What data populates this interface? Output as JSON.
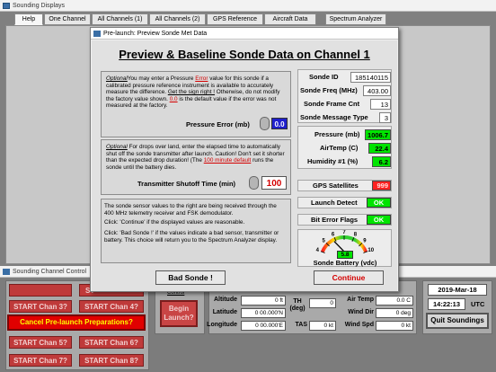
{
  "main_window": {
    "title": "Sounding Displays",
    "tabs": [
      "Help",
      "One Channel",
      "All Channels (1)",
      "All Channels (2)",
      "GPS Reference",
      "Aircraft Data",
      "Spectrum Analyzer"
    ]
  },
  "dialog": {
    "title": "Pre-launch:  Preview Sonde Met Data",
    "heading": "Preview & Baseline Sonde Data on Channel 1",
    "pressure_section": {
      "optional": "Optional",
      "text1": "You may enter a Pressure ",
      "error_word": "Error",
      "text2": " value for this sonde if a calibrated pressure reference instrument is available to accurately measure the difference.  ",
      "sign_right": "Get the sign right !",
      "text3": " Otherwise, do not modify the factory value shown.  ",
      "default_val": "0.0",
      "text4": " is the default value if the error was not measured at the factory.",
      "field_label": "Pressure Error (mb)",
      "field_value": "0.0"
    },
    "shutoff_section": {
      "optional": "Optional",
      "text1": "For drops over land, enter the elapsed time to automatically shut off the sonde transmitter after launch. Caution!  Don't set it shorter than the expected drop duration!  (The ",
      "default_link": "100 minute default",
      "text2": " runs the sonde until the battery dies.",
      "field_label": "Transmitter Shutoff Time (min)",
      "field_value": "100"
    },
    "info_section": {
      "text1": "The sonde sensor values to the right are being received through the 400 MHz telemetry receiver and FSK demodulator.",
      "text2": "Click:  'Continue'  if the displayed values are reasonable.",
      "text3": "Click: 'Bad Sonde !'  if the values indicate a bad sensor, transmitter or battery.  This choice will return you to the Spectrum Analyzer display."
    },
    "sonde_info": {
      "sonde_id_label": "Sonde ID",
      "sonde_id": "185140115",
      "freq_label": "Sonde Freq (MHz)",
      "freq": "403.00",
      "frame_label": "Sonde Frame Cnt",
      "frame": "13",
      "msgtype_label": "Sonde Message Type",
      "msgtype": "3"
    },
    "met": {
      "pressure_label": "Pressure (mb)",
      "pressure": "1006.7",
      "airtemp_label": "AirTemp (C)",
      "airtemp": "22.4",
      "humidity_label": "Humidity #1 (%)",
      "humidity": "6.2"
    },
    "status": {
      "gps_label": "GPS Satellites",
      "gps_value": "999",
      "launch_label": "Launch Detect",
      "launch_value": "OK",
      "bit_label": "Bit Error Flags",
      "bit_value": "OK"
    },
    "battery": {
      "label": "Sonde Battery (vdc)",
      "value": "5.8",
      "level": 5.8,
      "ticks": [
        "4",
        "5",
        "6",
        "7",
        "8",
        "9",
        "10"
      ]
    },
    "bad_sonde_label": "Bad Sonde !",
    "continue_label": "Continue"
  },
  "channel_control": {
    "title": "Sounding Channel Control",
    "start_buttons": [
      "START Chan 2?",
      "START Chan 3?",
      "START Chan 4?",
      "START Chan 5?",
      "START Chan 6?",
      "START Chan 7?",
      "START Chan 8?"
    ],
    "start_partial": "ST",
    "cancel_label": "Cancel Pre-launch Preparations?",
    "control_partial": "Control",
    "begin_label": "Begin Launch?",
    "altitude_label": "Altitude",
    "altitude": "0 ft",
    "latitude_label": "Latitude",
    "latitude": "0 00.000'N",
    "longitude_label": "Longitude",
    "longitude": "0 00.000'E",
    "th_label": "TH (deg)",
    "th": "0",
    "tas_label": "TAS",
    "tas": "0 kt",
    "airtemp_label": "Air Temp",
    "airtemp": "0.0 C",
    "winddir_label": "Wind Dir",
    "winddir": "0 deg",
    "windspd_label": "Wind Spd",
    "windspd": "0 kt",
    "date": "2019-Mar-18",
    "time": "14:22:13",
    "tz": "UTC",
    "quit_label": "Quit Soundings"
  }
}
